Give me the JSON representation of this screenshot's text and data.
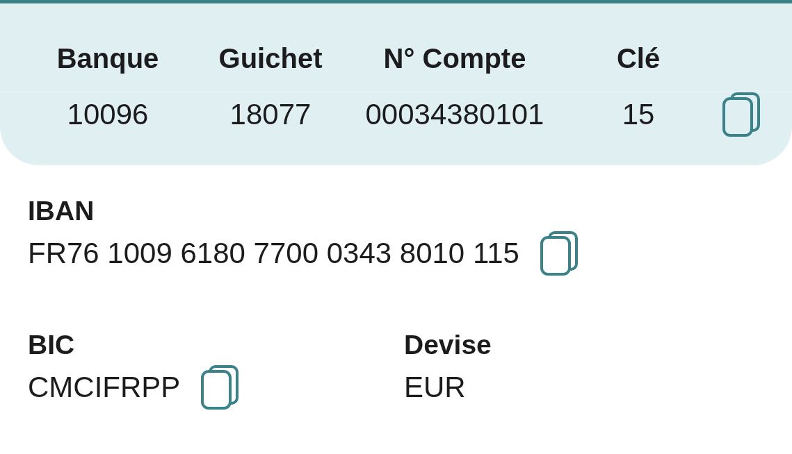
{
  "account_table": {
    "columns": [
      "Banque",
      "Guichet",
      "N° Compte",
      "Clé"
    ],
    "row": [
      "10096",
      "18077",
      "00034380101",
      "15"
    ],
    "copyable": true
  },
  "sections": [
    {
      "fields": [
        {
          "label": "IBAN",
          "value": "FR76 1009 6180 7700 0343 8010 115",
          "copyable": true
        }
      ]
    },
    {
      "fields": [
        {
          "label": "BIC",
          "value": "CMCIFRPP",
          "copyable": true
        },
        {
          "label": "Devise",
          "value": "EUR",
          "copyable": false
        }
      ]
    }
  ]
}
